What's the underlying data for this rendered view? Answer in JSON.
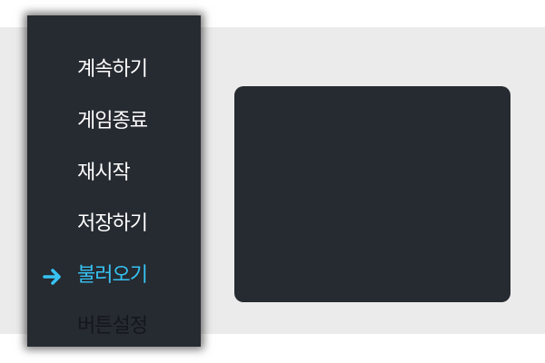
{
  "menu": {
    "items": [
      {
        "label": "계속하기",
        "state": "normal"
      },
      {
        "label": "게임종료",
        "state": "normal"
      },
      {
        "label": "재시작",
        "state": "normal"
      },
      {
        "label": "저장하기",
        "state": "normal"
      },
      {
        "label": "불러오기",
        "state": "selected"
      },
      {
        "label": "버튼설정",
        "state": "disabled"
      }
    ],
    "selected_index": 4,
    "selector_icon": "arrow-right-icon"
  },
  "colors": {
    "menu_background": "#262a31",
    "backdrop": "#ebebeb",
    "text_normal": "#ffffff",
    "text_selected": "#36c3f2",
    "text_disabled": "#14171b"
  }
}
